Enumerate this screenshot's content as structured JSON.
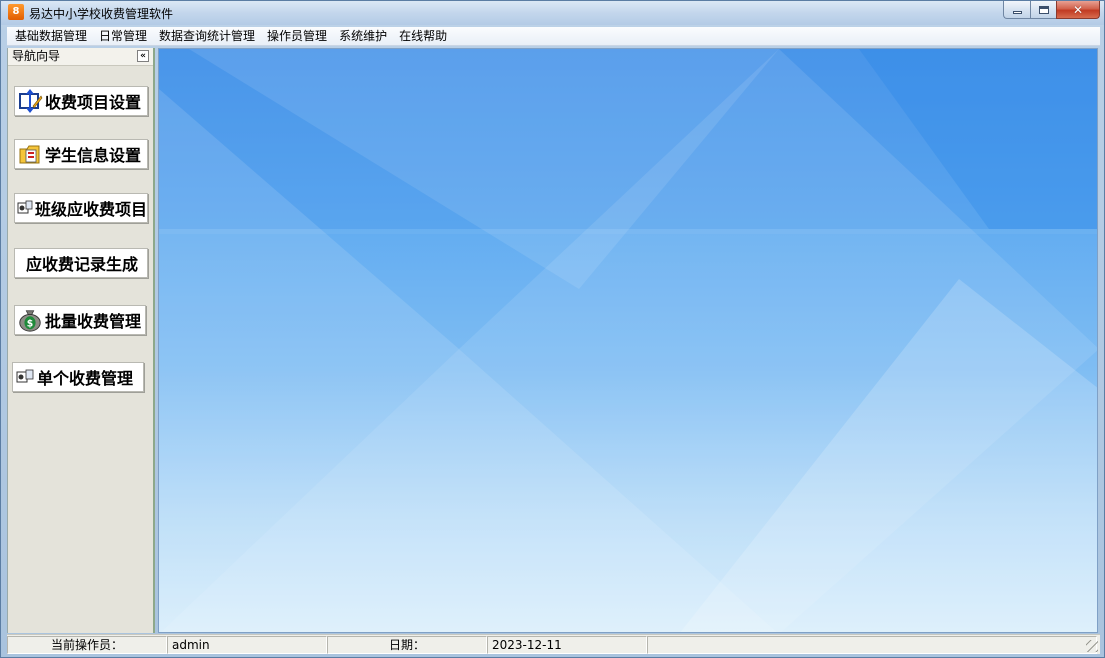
{
  "window": {
    "title": "易达中小学校收费管理软件",
    "icon_label": "8"
  },
  "menubar": {
    "items": [
      "基础数据管理",
      "日常管理",
      "数据查询统计管理",
      "操作员管理",
      "系统维护",
      "在线帮助"
    ]
  },
  "nav": {
    "header": "导航向导",
    "collapse_glyph": "«",
    "buttons": [
      {
        "label": "收费项目设置",
        "icon": "fee-items-icon"
      },
      {
        "label": "学生信息设置",
        "icon": "student-info-icon"
      },
      {
        "label": "班级应收费项目",
        "icon": "class-fee-icon"
      },
      {
        "label": "应收费记录生成",
        "icon": ""
      },
      {
        "label": "批量收费管理",
        "icon": "money-bag-icon"
      },
      {
        "label": "单个收费管理",
        "icon": "single-fee-icon"
      }
    ]
  },
  "statusbar": {
    "operator_label": "当前操作员：",
    "operator_value": "admin",
    "date_label": "日期：",
    "date_value": "2023-12-11",
    "extra": ""
  },
  "colors": {
    "main_top": "#4c97ea",
    "main_bottom": "#d7edfb",
    "nav_bg": "#e4e3da",
    "close_red": "#c13a22"
  }
}
